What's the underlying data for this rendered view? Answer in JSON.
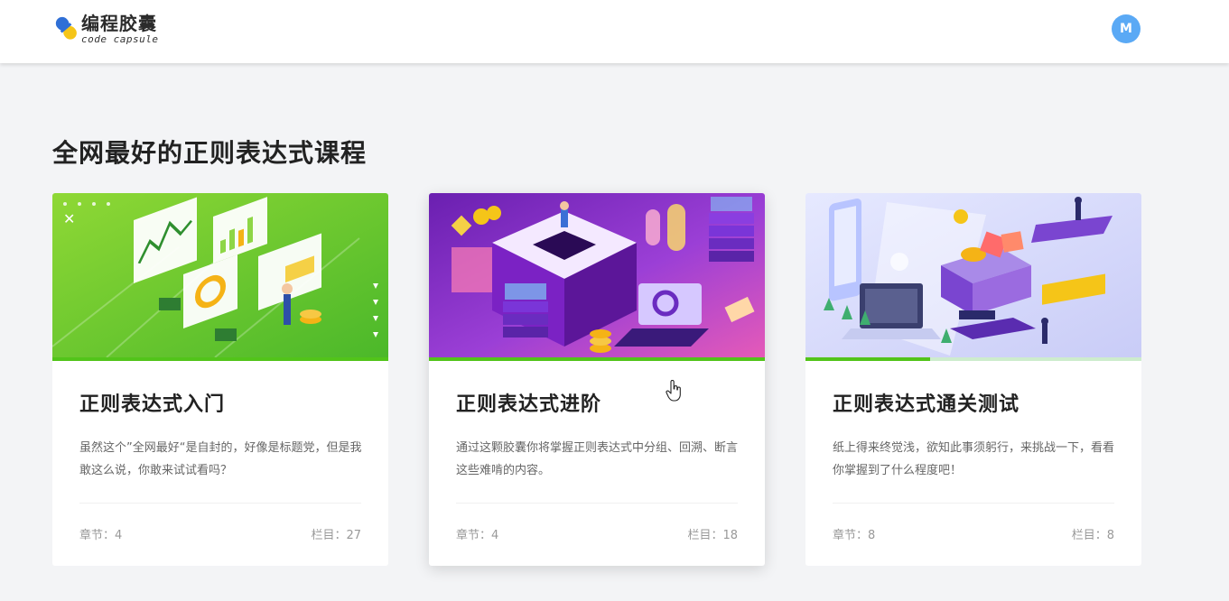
{
  "header": {
    "logo_title": "编程胶囊",
    "logo_subtitle": "code capsule",
    "avatar_initial": "M"
  },
  "main": {
    "title": "全网最好的正则表达式课程",
    "courses": [
      {
        "title": "正则表达式入门",
        "description": "虽然这个”全网最好“是自封的，好像是标题党，但是我敢这么说，你敢来试试看吗？",
        "chapters_label": "章节：",
        "chapters": "4",
        "sections_label": "栏目：",
        "sections": "27",
        "progress": 1.0
      },
      {
        "title": "正则表达式进阶",
        "description": "通过这颗胶囊你将掌握正则表达式中分组、回溯、断言这些难啃的内容。",
        "chapters_label": "章节：",
        "chapters": "4",
        "sections_label": "栏目：",
        "sections": "18",
        "progress": 1.0
      },
      {
        "title": "正则表达式通关测试",
        "description": "纸上得来终觉浅，欲知此事须躬行，来挑战一下，看看你掌握到了什么程度吧！",
        "chapters_label": "章节：",
        "chapters": "8",
        "sections_label": "栏目：",
        "sections": "8",
        "progress": 0.37
      }
    ]
  },
  "colors": {
    "accent_green": "#52c41a",
    "progress_track": "#cdeccd",
    "avatar_blue": "#5aa9f5"
  }
}
